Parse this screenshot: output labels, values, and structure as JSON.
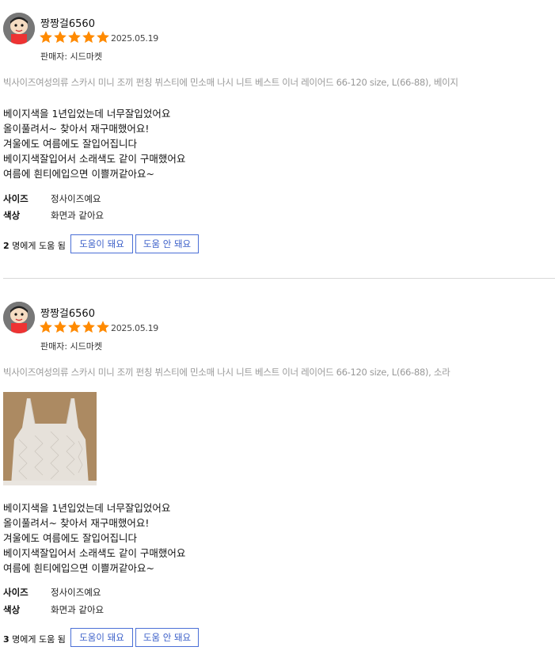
{
  "reviews": [
    {
      "username": "짱짱걸6560",
      "date": "2025.05.19",
      "rating": 5,
      "seller": "판매자: 시드마켓",
      "option": "빅사이즈여성의류 스카시 미니 조끼 펀칭 뷔스티에 민소매 나시 니트 베스트 이너 레이어드 66-120 size, L(66-88), 베이지",
      "lines": [
        "베이지색을 1년입었는데 너무잘입었어요",
        "올이풀려서~ 찾아서 재구매했어요!",
        "겨울에도 여름에도 잘입어집니다",
        "베이지색잘입어서 소래색도 같이 구매했어요",
        "여름에 흰티에입으면 이쁠꺼같아요~"
      ],
      "attrs": [
        {
          "key": "사이즈",
          "value": "정사이즈예요"
        },
        {
          "key": "색상",
          "value": "화면과 같아요"
        }
      ],
      "helpful_count": "2",
      "helpful_suffix": " 명에게 도움 됨",
      "btn_yes": "도움이 돼요",
      "btn_no": "도움 안 돼요"
    },
    {
      "username": "짱짱걸6560",
      "date": "2025.05.19",
      "rating": 5,
      "seller": "판매자: 시드마켓",
      "option": "빅사이즈여성의류 스카시 미니 조끼 펀칭 뷔스티에 민소매 나시 니트 베스트 이너 레이어드 66-120 size, L(66-88), 소라",
      "lines": [
        "베이지색을 1년입었는데 너무잘입었어요",
        "올이풀려서~ 찾아서 재구매했어요!",
        "겨울에도 여름에도 잘입어집니다",
        "베이지색잘입어서 소래색도 같이 구매했어요",
        "여름에 흰티에입으면 이쁠꺼같아요~"
      ],
      "attrs": [
        {
          "key": "사이즈",
          "value": "정사이즈예요"
        },
        {
          "key": "색상",
          "value": "화면과 같아요"
        }
      ],
      "helpful_count": "3",
      "helpful_suffix": " 명에게 도움 됨",
      "btn_yes": "도움이 돼요",
      "btn_no": "도움 안 돼요"
    }
  ],
  "colors": {
    "star": "#ff8a00",
    "button_border": "#4a6fd6",
    "button_text": "#3b5fc8",
    "divider": "#d9d9d9"
  }
}
